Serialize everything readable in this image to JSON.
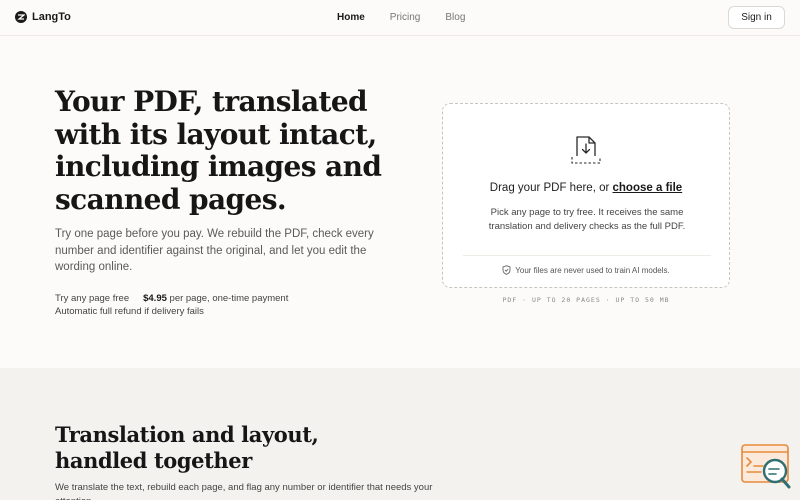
{
  "brand": {
    "name": "LangTo",
    "icon": "logo-mark-icon"
  },
  "nav": {
    "links": [
      {
        "label": "Home",
        "active": true
      },
      {
        "label": "Pricing",
        "active": false
      },
      {
        "label": "Blog",
        "active": false
      }
    ],
    "signin_label": "Sign in"
  },
  "hero": {
    "title": "Your PDF, translated with its layout intact, including images and scanned pages.",
    "subtitle": "Try one page before you pay. We rebuild the PDF, check every number and identifier against the original, and let you edit the wording online.",
    "pricing": {
      "free_label": "Try any page free",
      "price": "$4.95",
      "price_suffix": "per page, one-time payment",
      "refund": "Automatic full refund if delivery fails"
    }
  },
  "upload": {
    "prompt": "Drag your PDF here, or",
    "choose_label": "choose a file",
    "description": "Pick any page to try free. It receives the same translation and delivery checks as the full PDF.",
    "privacy_note": "Your files are never used to train AI models.",
    "limits": "PDF · UP TO 20 PAGES · UP TO 50 MB",
    "icons": [
      "document-download-icon",
      "shield-check-icon"
    ]
  },
  "section2": {
    "title": "Translation and layout, handled together",
    "subtitle": "We translate the text, rebuild each page, and flag any number or identifier that needs your attention."
  },
  "help_widget": {
    "icon": "chat-search-icon"
  },
  "colors": {
    "accent": "#e8893a",
    "accent_dark": "#2f6f73",
    "ink": "#1a1a1a",
    "background": "#fcfbf9"
  }
}
